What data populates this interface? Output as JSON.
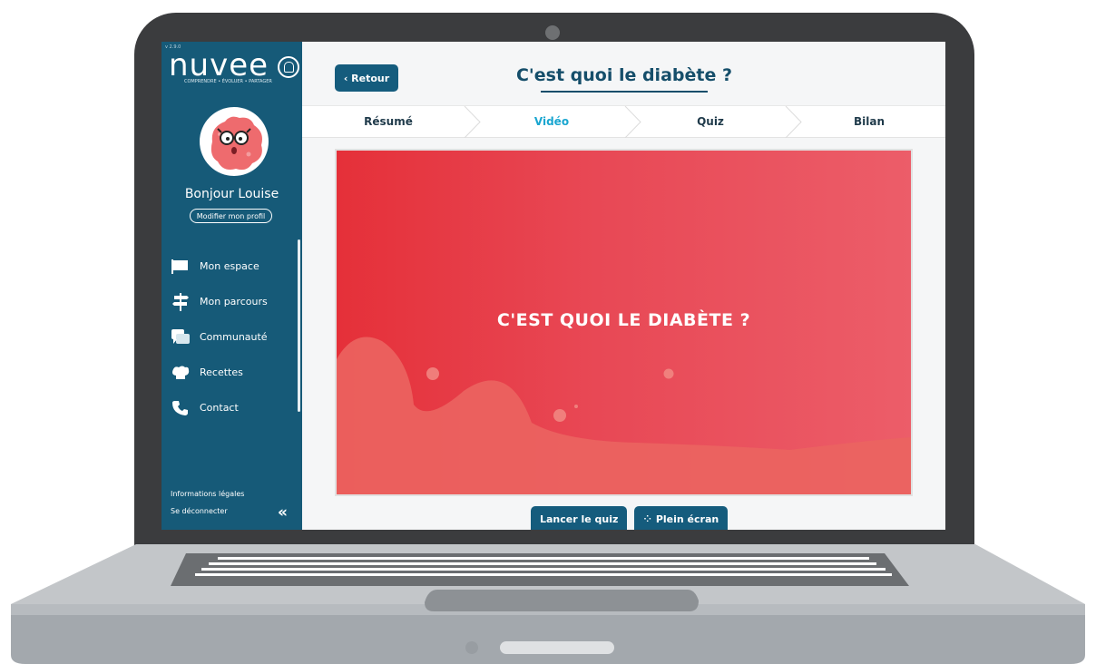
{
  "app": {
    "version": "v 2.9.0",
    "logo_text": "nuvee",
    "tagline": "COMPRENDRE • ÉVOLUER • PARTAGER"
  },
  "sidebar": {
    "greeting": "Bonjour Louise",
    "edit_profile_label": "Modifier mon profil",
    "items": [
      {
        "label": "Mon espace",
        "icon": "flag-icon"
      },
      {
        "label": "Mon parcours",
        "icon": "signpost-icon"
      },
      {
        "label": "Communauté",
        "icon": "chat-icon"
      },
      {
        "label": "Recettes",
        "icon": "recipe-icon"
      },
      {
        "label": "Contact",
        "icon": "phone-icon"
      }
    ],
    "legal_label": "Informations légales",
    "logout_label": "Se déconnecter",
    "collapse_glyph": "«"
  },
  "header": {
    "back_label": "‹ Retour",
    "title": "C'est quoi le diabète ?"
  },
  "tabs": [
    {
      "label": "Résumé",
      "active": false
    },
    {
      "label": "Vidéo",
      "active": true
    },
    {
      "label": "Quiz",
      "active": false
    },
    {
      "label": "Bilan",
      "active": false
    }
  ],
  "video": {
    "title": "C'EST QUOI LE DIABÈTE ?"
  },
  "actions": {
    "quiz_label": "Lancer le quiz",
    "fullscreen_label": "Plein écran"
  },
  "colors": {
    "sidebar": "#165a78",
    "primary_button": "#155c7d",
    "active_tab": "#1aa6d0",
    "video_red": "#e53039"
  }
}
